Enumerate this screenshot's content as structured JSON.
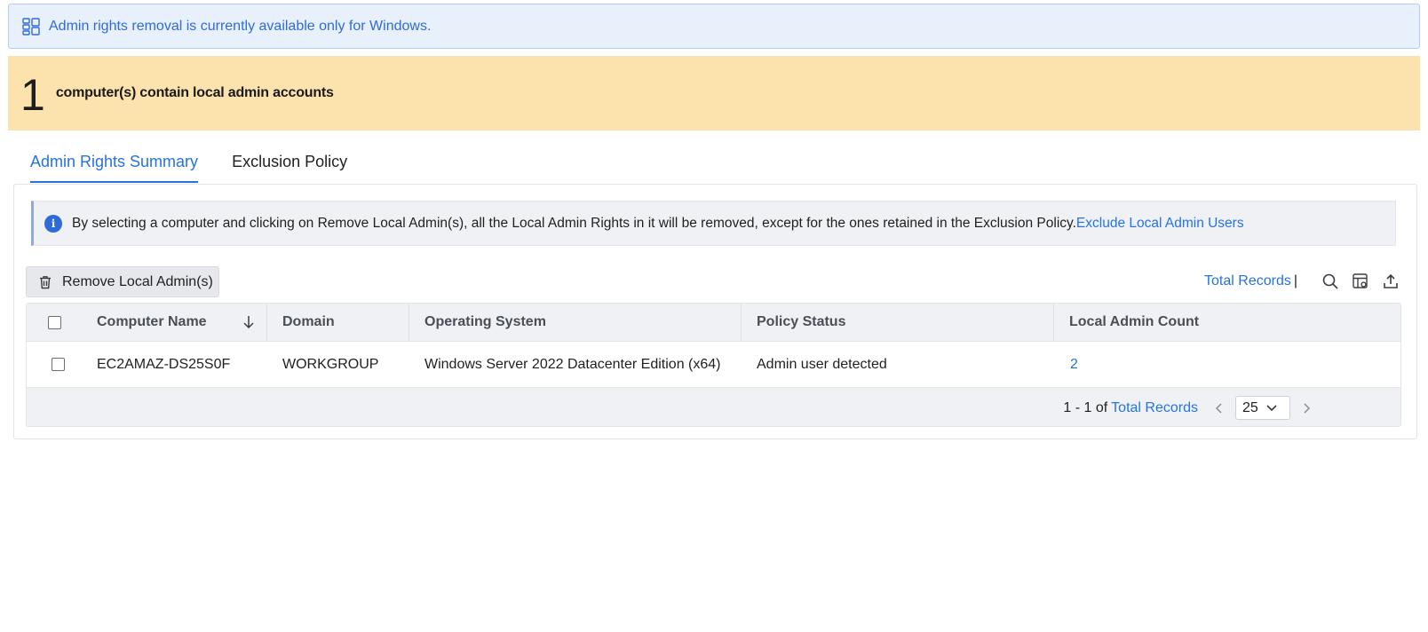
{
  "notice": {
    "text": "Admin rights removal is currently available only for Windows.",
    "icon": "windows-grid-icon",
    "color": "#2f6bd8"
  },
  "summary": {
    "count": "1",
    "text": "computer(s) contain local admin accounts",
    "background": "#fce3ad"
  },
  "tabs": [
    {
      "label": "Admin Rights Summary",
      "active": true
    },
    {
      "label": "Exclusion Policy",
      "active": false
    }
  ],
  "info": {
    "text": "By selecting a computer and clicking on Remove Local Admin(s), all the Local Admin Rights in it will be removed, except for the ones retained in the Exclusion Policy.",
    "link": "Exclude Local Admin Users"
  },
  "toolbar": {
    "remove_label": "Remove Local Admin(s)",
    "total_records_label": "Total Records",
    "separator": "|",
    "icons": [
      "search-icon",
      "column-settings-icon",
      "export-icon"
    ]
  },
  "table": {
    "columns": [
      "Computer Name",
      "Domain",
      "Operating System",
      "Policy Status",
      "Local Admin Count"
    ],
    "sort": {
      "column": "Computer Name",
      "direction": "descending"
    },
    "rows": [
      {
        "computer_name": "EC2AMAZ-DS25S0F",
        "domain": "WORKGROUP",
        "os": "Windows Server 2022 Datacenter Edition (x64)",
        "policy_status": "Admin user detected",
        "admin_count": "2"
      }
    ]
  },
  "pagination": {
    "range": "1 - 1 of",
    "total_label": "Total Records",
    "page_size": "25"
  },
  "colors": {
    "accent": "#2673dd",
    "header_bg": "#eff1f4"
  }
}
